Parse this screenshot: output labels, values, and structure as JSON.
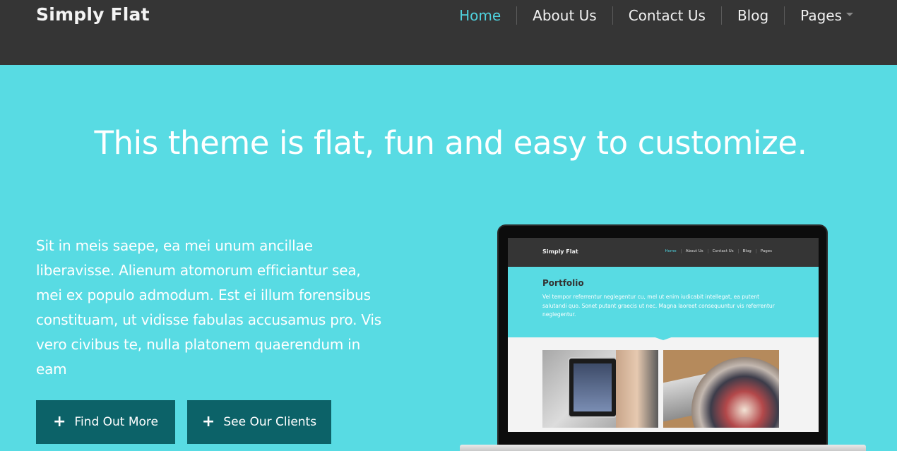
{
  "header": {
    "brand": "Simply Flat",
    "nav": [
      {
        "label": "Home",
        "active": true
      },
      {
        "label": "About Us"
      },
      {
        "label": "Contact Us"
      },
      {
        "label": "Blog"
      },
      {
        "label": "Pages",
        "dropdown": true
      }
    ]
  },
  "hero": {
    "headline": "This theme is flat, fun and easy to customize.",
    "lead": "Sit in meis saepe, ea mei unum ancillae liberavisse. Alienum atomorum efficiantur sea, mei ex populo admodum. Est ei illum forensibus constituam, ut vidisse fabulas accusamus pro. Vis vero civibus te, nulla platonem quaerendum in eam",
    "buttons": [
      {
        "label": "Find Out More",
        "icon": "plus-icon"
      },
      {
        "label": "See Our Clients",
        "icon": "plus-icon"
      }
    ]
  },
  "mockup": {
    "brand": "Simply Flat",
    "nav": [
      "Home",
      "About Us",
      "Contact Us",
      "Blog",
      "Pages"
    ],
    "title": "Portfolio",
    "text": "Vel tempor referrentur neglegentur cu, mel ut enim iudicabit intellegat, ea putent salutandi quo. Sonet putant graecis ut nec. Magna laoreet consequuntur vis referrentur neglegentur."
  },
  "colors": {
    "accent": "#58dbe3",
    "header": "#353535",
    "button": "#0c6268",
    "nav_active": "#4fd2de"
  }
}
